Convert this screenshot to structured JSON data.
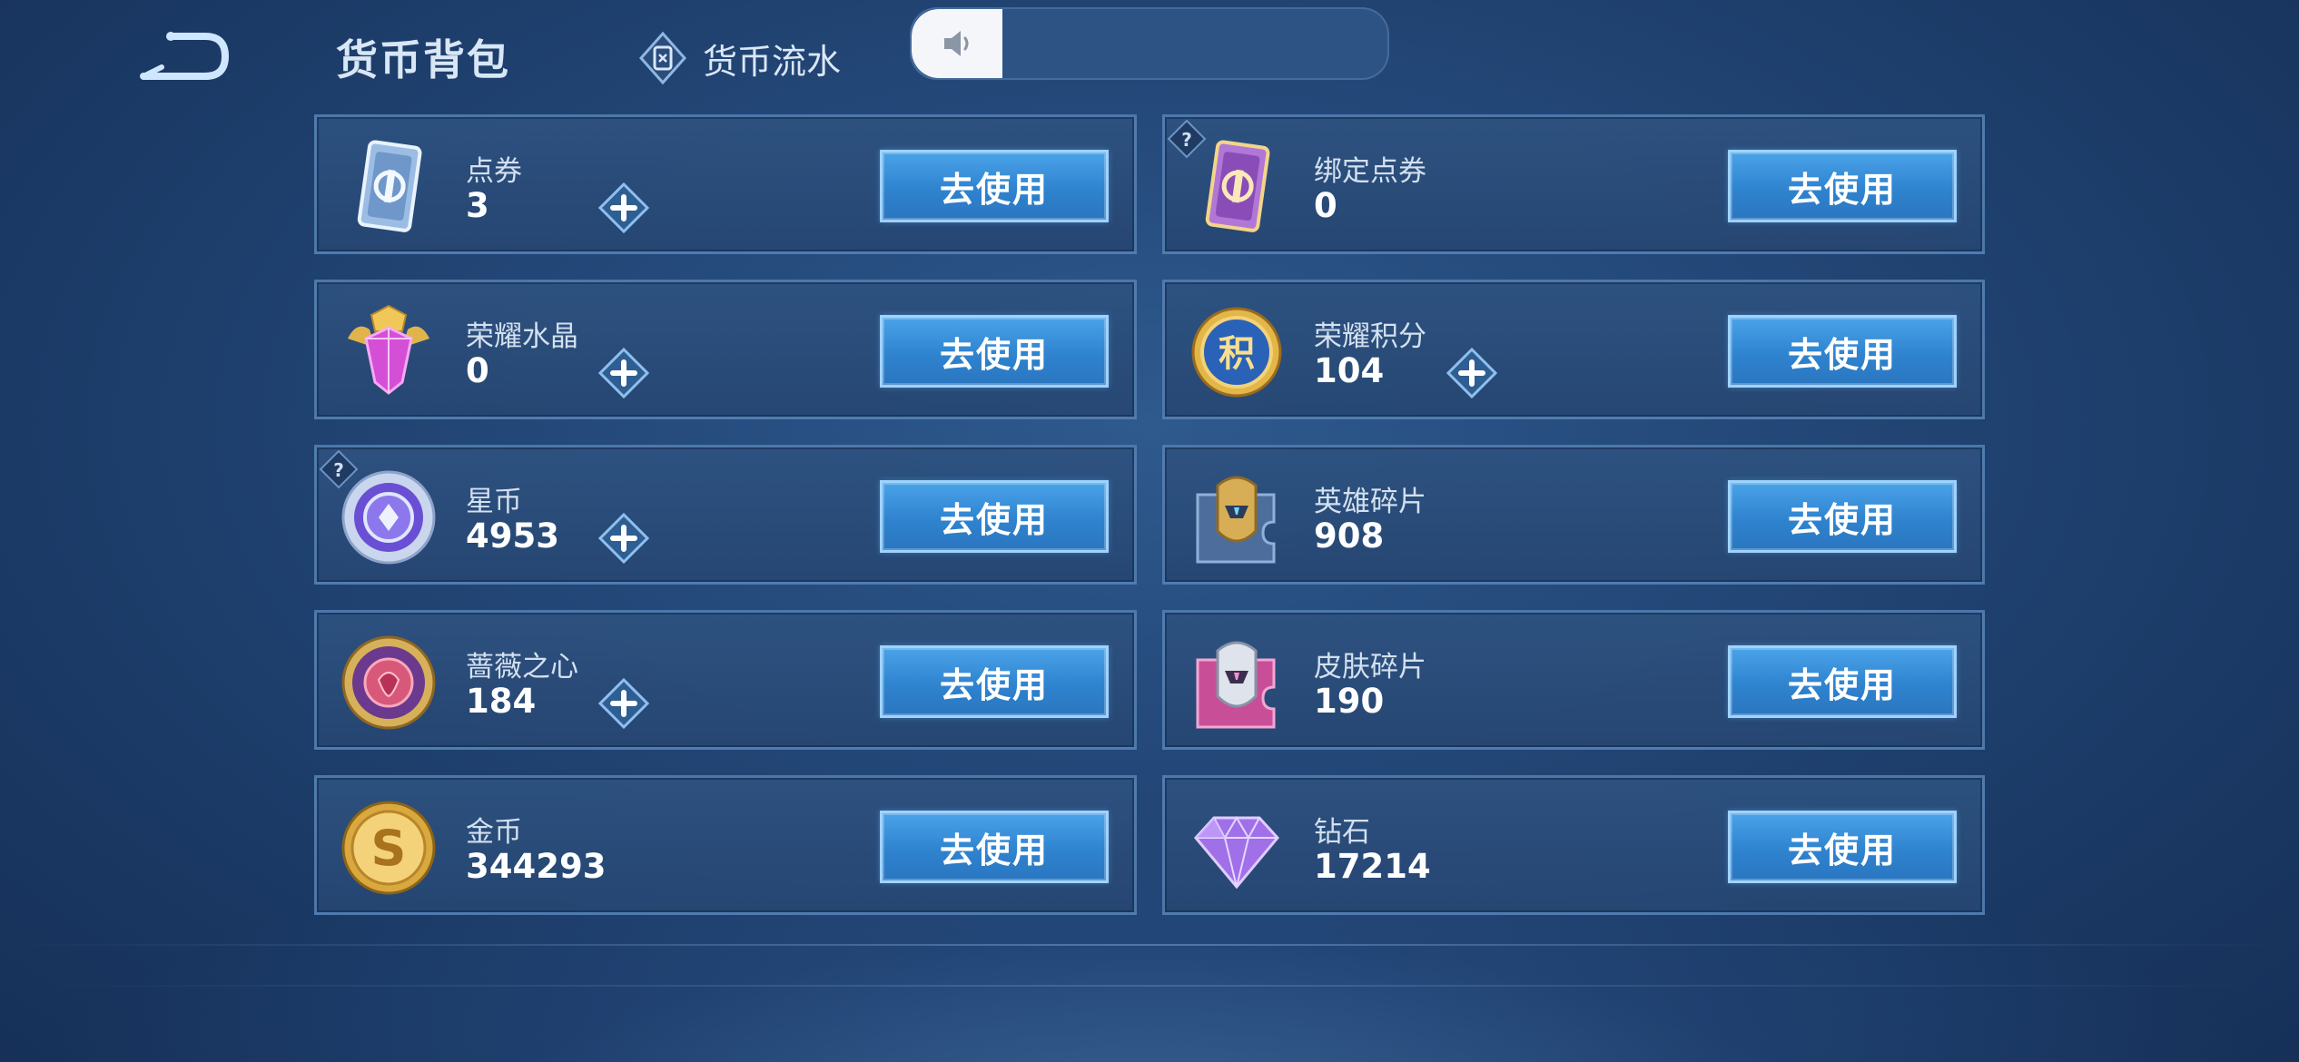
{
  "header": {
    "title": "货币背包",
    "flow_tab_label": "货币流水",
    "back_icon": "back-arrow-icon",
    "volume_icon": "speaker-icon",
    "volume_level": 0.19
  },
  "currencies": [
    {
      "name": "点券",
      "value": "3",
      "icon": "voucher-card-icon",
      "has_plus": true,
      "has_help": false,
      "button": "去使用"
    },
    {
      "name": "绑定点券",
      "value": "0",
      "icon": "bound-voucher-card-icon",
      "has_plus": false,
      "has_help": true,
      "button": "去使用"
    },
    {
      "name": "荣耀水晶",
      "value": "0",
      "icon": "glory-crystal-icon",
      "has_plus": true,
      "has_help": false,
      "button": "去使用"
    },
    {
      "name": "荣耀积分",
      "value": "104",
      "icon": "glory-points-icon",
      "has_plus": true,
      "has_help": false,
      "button": "去使用"
    },
    {
      "name": "星币",
      "value": "4953",
      "icon": "star-coin-icon",
      "has_plus": true,
      "has_help": true,
      "button": "去使用"
    },
    {
      "name": "英雄碎片",
      "value": "908",
      "icon": "hero-fragment-icon",
      "has_plus": false,
      "has_help": false,
      "button": "去使用"
    },
    {
      "name": "蔷薇之心",
      "value": "184",
      "icon": "rose-heart-icon",
      "has_plus": true,
      "has_help": false,
      "button": "去使用"
    },
    {
      "name": "皮肤碎片",
      "value": "190",
      "icon": "skin-fragment-icon",
      "has_plus": false,
      "has_help": false,
      "button": "去使用"
    },
    {
      "name": "金币",
      "value": "344293",
      "icon": "gold-coin-icon",
      "has_plus": false,
      "has_help": false,
      "button": "去使用"
    },
    {
      "name": "钻石",
      "value": "17214",
      "icon": "diamond-icon",
      "has_plus": false,
      "has_help": false,
      "button": "去使用"
    }
  ],
  "colors": {
    "accent": "#3a8fd9",
    "card_border": "#6ea0d7"
  }
}
